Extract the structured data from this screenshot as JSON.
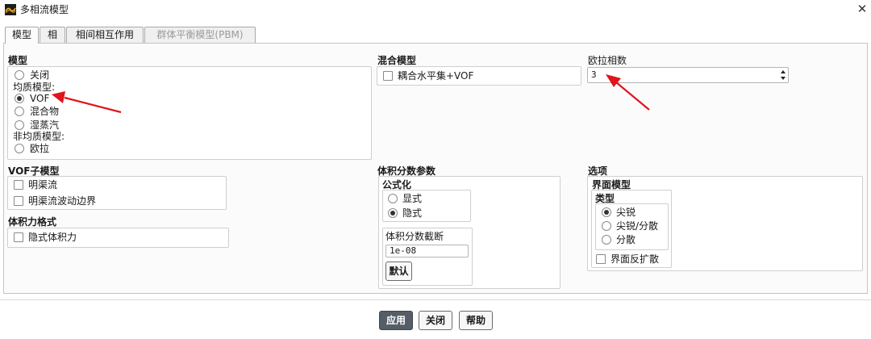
{
  "window": {
    "title": "多相流模型",
    "close_glyph": "✕"
  },
  "tabs": [
    {
      "label": "模型",
      "state": "active"
    },
    {
      "label": "相",
      "state": "normal"
    },
    {
      "label": "相间相互作用",
      "state": "normal"
    },
    {
      "label": "群体平衡模型(PBM)",
      "state": "disabled"
    }
  ],
  "model": {
    "header": "模型",
    "off_label": "关闭",
    "homogeneous_header": "均质模型:",
    "vof_label": "VOF",
    "mixture_label": "混合物",
    "wet_steam_label": "湿蒸汽",
    "inhomogeneous_header": "非均质模型:",
    "eulerian_label": "欧拉",
    "selected": "VOF"
  },
  "mixing_model": {
    "header": "混合模型",
    "coupled_label": "耦合水平集+VOF",
    "coupled_checked": false
  },
  "euler_phases": {
    "header": "欧拉相数",
    "value": "3"
  },
  "vof_submodel": {
    "header": "VOF子模型",
    "open_channel_label": "明渠流",
    "open_channel_wave_label": "明渠流波动边界",
    "open_channel_checked": false,
    "open_channel_wave_checked": false
  },
  "body_force": {
    "header": "体积力格式",
    "implicit_label": "隐式体积力",
    "implicit_checked": false
  },
  "vf_params": {
    "header": "体积分数参数",
    "formulation_header": "公式化",
    "explicit_label": "显式",
    "implicit_label": "隐式",
    "selected": "隐式",
    "cutoff_header": "体积分数截断",
    "cutoff_value": "1e-08",
    "default_button": "默认"
  },
  "options": {
    "header": "选项",
    "interface_header": "界面模型",
    "type_header": "类型",
    "sharp_label": "尖锐",
    "sharp_dispersed_label": "尖锐/分散",
    "dispersed_label": "分散",
    "selected": "尖锐",
    "anti_diffusion_label": "界面反扩散",
    "anti_diffusion_checked": false
  },
  "footer": {
    "apply_label": "应用",
    "close_label": "关闭",
    "help_label": "帮助"
  },
  "annotations": {
    "arrow_color": "#e0141b"
  },
  "colors": {
    "primary_button": "#555e66",
    "panel_bg": "#fbfbfb"
  }
}
